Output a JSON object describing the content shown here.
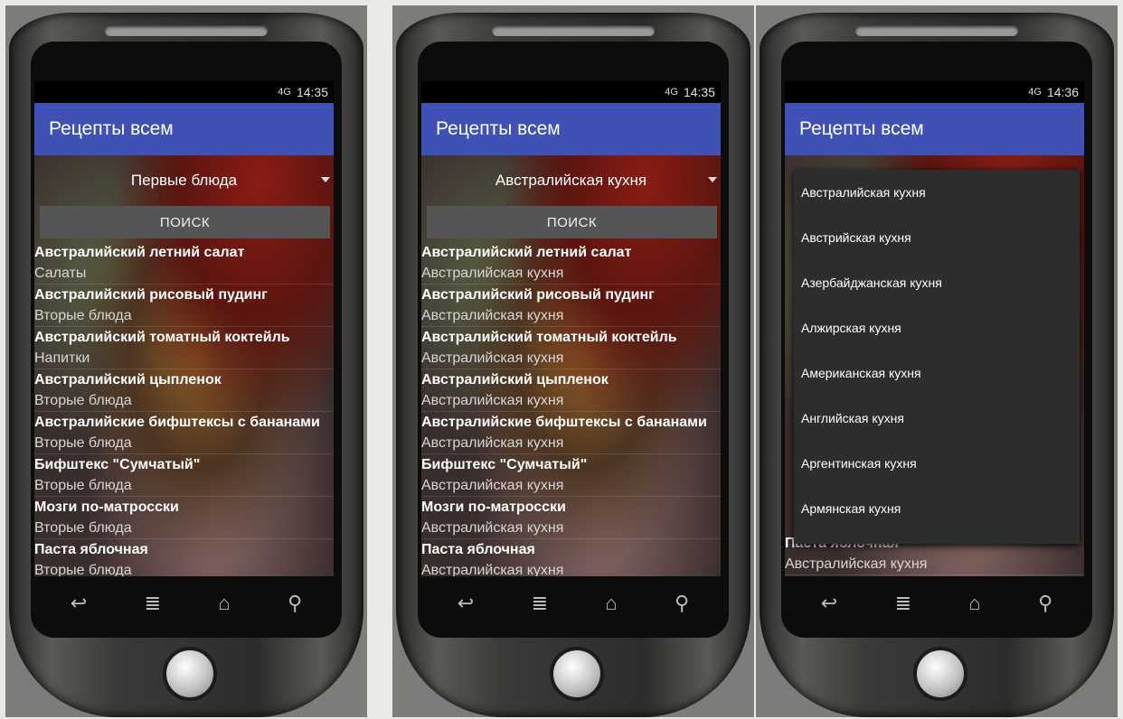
{
  "screens": [
    {
      "time": "14:35",
      "signal": "4G",
      "app_title": "Рецепты всем",
      "spinner_value": "Первые блюда",
      "search_label": "ПОИСК",
      "recipes": [
        {
          "title": "Австралийский летний салат",
          "category": "Салаты"
        },
        {
          "title": "Австралийский рисовый пудинг",
          "category": "Вторые блюда"
        },
        {
          "title": "Австралийский томатный коктейль",
          "category": "Напитки"
        },
        {
          "title": "Австралийский цыпленок",
          "category": "Вторые блюда"
        },
        {
          "title": "Австралийские бифштексы с бананами",
          "category": "Вторые блюда"
        },
        {
          "title": "Бифштекс \"Сумчатый\"",
          "category": "Вторые блюда"
        },
        {
          "title": "Мозги по-матросски",
          "category": "Вторые блюда"
        },
        {
          "title": "Паста яблочная",
          "category": "Вторые блюда"
        }
      ]
    },
    {
      "time": "14:35",
      "signal": "4G",
      "app_title": "Рецепты всем",
      "spinner_value": "Австралийская кухня",
      "search_label": "ПОИСК",
      "recipes": [
        {
          "title": "Австралийский летний салат",
          "category": "Австралийская кухня"
        },
        {
          "title": "Австралийский рисовый пудинг",
          "category": "Австралийская кухня"
        },
        {
          "title": "Австралийский томатный коктейль",
          "category": "Австралийская кухня"
        },
        {
          "title": "Австралийский цыпленок",
          "category": "Австралийская кухня"
        },
        {
          "title": "Австралийские бифштексы с бананами",
          "category": "Австралийская кухня"
        },
        {
          "title": "Бифштекс \"Сумчатый\"",
          "category": "Австралийская кухня"
        },
        {
          "title": "Мозги по-матросски",
          "category": "Австралийская кухня"
        },
        {
          "title": "Паста яблочная",
          "category": "Австралийская кухня"
        }
      ]
    },
    {
      "time": "14:36",
      "signal": "4G",
      "app_title": "Рецепты всем",
      "dropdown_options": [
        "Австралийская кухня",
        "Австрийская кухня",
        "Азербайджанская кухня",
        "Алжирская кухня",
        "Американская кухня",
        "Английская кухня",
        "Аргентинская кухня",
        "Армянская кухня"
      ],
      "visible_recipe": {
        "title": "Паста яблочная",
        "category": "Австралийская кухня"
      }
    }
  ],
  "nav_icons": [
    "back-icon",
    "menu-icon",
    "home-icon",
    "search-icon"
  ]
}
